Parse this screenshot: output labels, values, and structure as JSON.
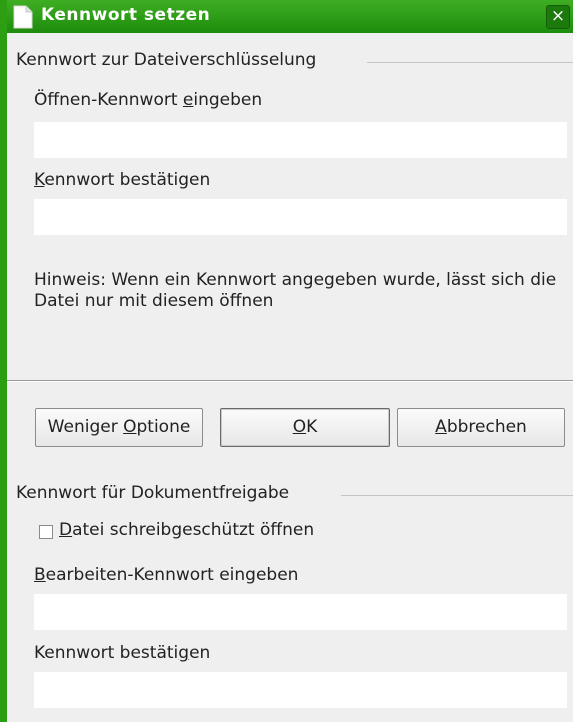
{
  "dialog": {
    "title": "Kennwort setzen",
    "close_symbol": "×"
  },
  "encryption": {
    "section_title": "Kennwort zur Dateiverschlüsselung",
    "open_password_label_pre": "Öffnen-Kennwort ",
    "open_password_label_mnemonic": "e",
    "open_password_label_post": "ingeben",
    "open_password_value": "",
    "confirm_label_mnemonic": "K",
    "confirm_label_post": "ennwort bestätigen",
    "confirm_value": "",
    "hint": "Hinweis: Wenn ein Kennwort angegeben wurde, lässt sich die Datei nur mit diesem öffnen"
  },
  "buttons": {
    "less_options_pre": "Weniger ",
    "less_options_mnemonic": "O",
    "less_options_post": "ptione",
    "ok_mnemonic": "O",
    "ok_post": "K",
    "cancel_mnemonic": "A",
    "cancel_post": "bbrechen"
  },
  "sharing": {
    "section_title": "Kennwort für Dokumentfreigabe",
    "readonly_checked": false,
    "readonly_mnemonic": "D",
    "readonly_post": "atei schreibgeschützt öffnen",
    "edit_password_mnemonic": "B",
    "edit_password_post": "earbeiten-Kennwort eingeben",
    "edit_password_value": "",
    "confirm_label_pre": "Kennwort bestäti",
    "confirm_label_mnemonic": "g",
    "confirm_label_post": "en",
    "confirm_value": ""
  },
  "colors": {
    "titlebar": "#2b9e12",
    "dialog_bg": "#efefef"
  },
  "icons": {
    "title": "document-icon",
    "close": "close-icon",
    "checkbox": "checkbox-icon"
  }
}
